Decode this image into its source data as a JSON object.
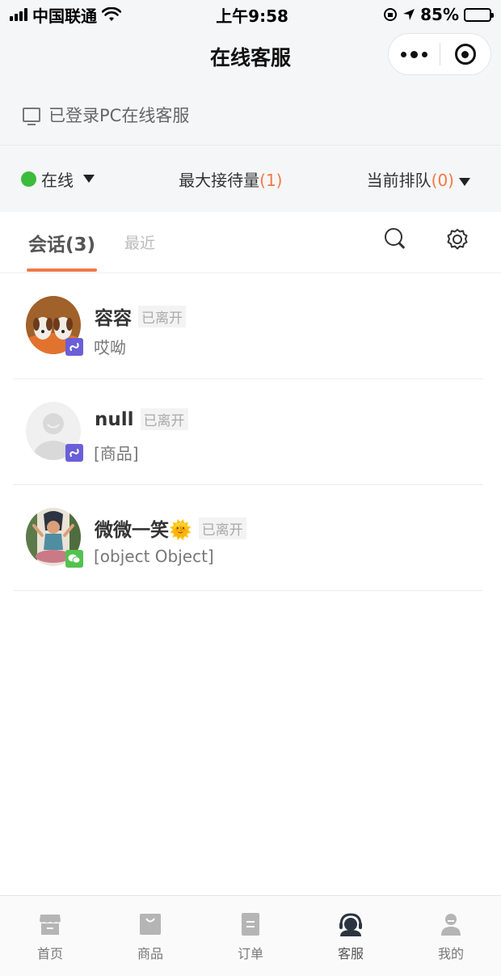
{
  "status_bar": {
    "carrier": "中国联通",
    "time": "上午9:58",
    "battery": "85%",
    "battery_level": 0.85
  },
  "nav": {
    "title": "在线客服"
  },
  "pc_status": {
    "text": "已登录PC在线客服"
  },
  "service_status": {
    "online_label": "在线",
    "max_label": "最大接待量",
    "max_count": "(1)",
    "queue_label": "当前排队",
    "queue_count": "(0)"
  },
  "tabs": [
    {
      "label": "会话(3)",
      "active": true
    },
    {
      "label": "最近",
      "active": false
    }
  ],
  "conversations": [
    {
      "name": "容容",
      "tag": "已离开",
      "message": "哎呦",
      "channel": "mini-program"
    },
    {
      "name": "null",
      "tag": "已离开",
      "message": "[商品]",
      "channel": "mini-program"
    },
    {
      "name": "微微一笑🌞",
      "tag": "已离开",
      "message": "[object Object]",
      "channel": "wechat"
    }
  ],
  "bottom_nav": [
    {
      "label": "首页",
      "icon": "store-icon"
    },
    {
      "label": "商品",
      "icon": "bag-icon"
    },
    {
      "label": "订单",
      "icon": "order-icon"
    },
    {
      "label": "客服",
      "icon": "headset-icon",
      "active": true
    },
    {
      "label": "我的",
      "icon": "user-icon"
    }
  ],
  "colors": {
    "accent": "#f27a3f",
    "online": "#3dbb3d",
    "mini_badge": "#6a5fd8",
    "wechat_badge": "#53c24f"
  }
}
